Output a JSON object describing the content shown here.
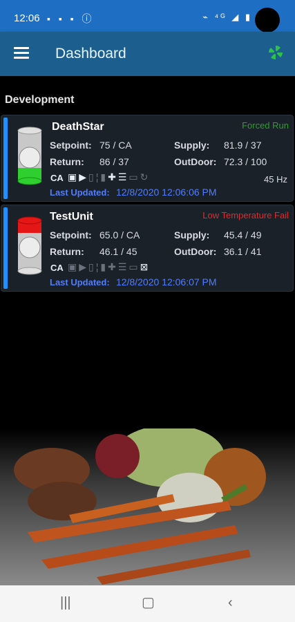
{
  "status_bar": {
    "time": "12:06",
    "left_icons": "▪ ▪ ▪ ⓘ",
    "right_icons": "⌁ ⁴ᴳ ◢ ▮"
  },
  "appbar": {
    "title": "Dashboard"
  },
  "section": {
    "title": "Development"
  },
  "units": [
    {
      "name": "DeathStar",
      "status": "Forced Run",
      "status_color": "#2e9e2e",
      "indicator": "green",
      "setpoint_label": "Setpoint:",
      "setpoint": "75 / CA",
      "return_label": "Return:",
      "return": "86 / 37",
      "supply_label": "Supply:",
      "supply": "81.9 / 37",
      "outdoor_label": "OutDoor:",
      "outdoor": "72.3 / 100",
      "mode": "CA",
      "hz": "45 Hz",
      "updated_label": "Last Updated:",
      "updated": "12/8/2020 12:06:06 PM"
    },
    {
      "name": "TestUnit",
      "status": "Low Temperature Fail",
      "status_color": "#e02b2b",
      "indicator": "red",
      "setpoint_label": "Setpoint:",
      "setpoint": "65.0 / CA",
      "return_label": "Return:",
      "return": "46.1 / 45",
      "supply_label": "Supply:",
      "supply": "45.4 / 49",
      "outdoor_label": "OutDoor:",
      "outdoor": "36.1 / 41",
      "mode": "CA",
      "hz": "",
      "updated_label": "Last Updated:",
      "updated": "12/8/2020 12:06:07 PM"
    }
  ],
  "colors": {
    "accent": "#1e90ff",
    "appbar": "#1c5f8f",
    "statusbar": "#1e6fc4",
    "link": "#4f7dff"
  }
}
